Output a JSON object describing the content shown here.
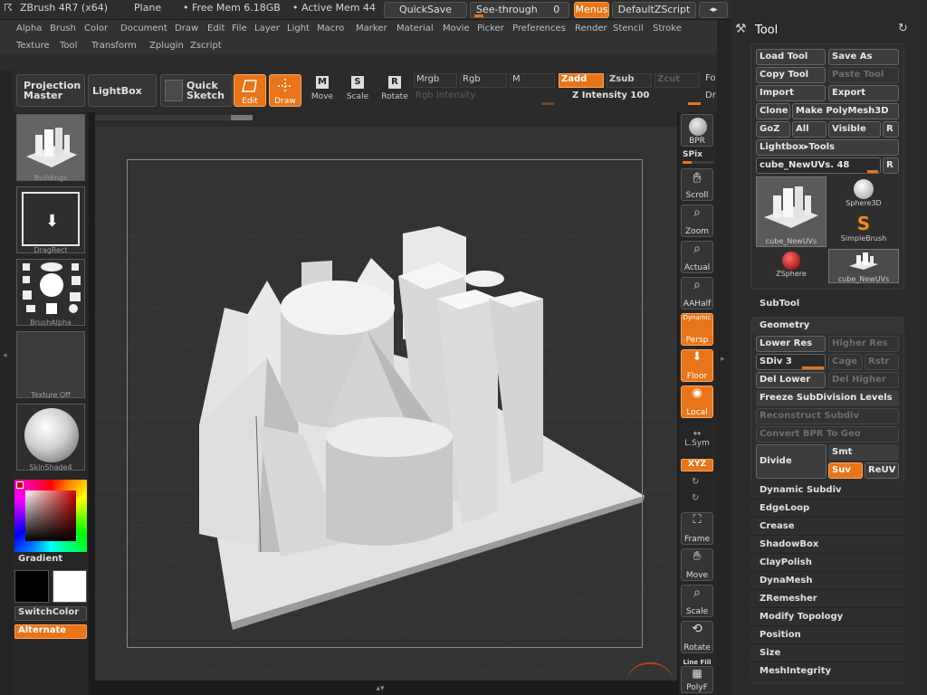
{
  "title": {
    "app": "ZBrush 4R7 (x64)",
    "doc": "Plane",
    "free_mem": "• Free Mem 6.18GB",
    "active_mem": "• Active Mem 44",
    "quicksave": "QuickSave",
    "see_through": "See-through",
    "see_through_value": "0",
    "menus": "Menus",
    "default_script": "DefaultZScript"
  },
  "menus": {
    "row1": [
      "Alpha",
      "Brush",
      "Color",
      "Document",
      "Draw",
      "Edit",
      "File",
      "Layer",
      "Light",
      "Macro",
      "Marker",
      "Material",
      "Movie",
      "Picker",
      "Preferences",
      "Render",
      "Stencil",
      "Stroke"
    ],
    "row2": [
      "Texture",
      "Tool",
      "Transform",
      "Zplugin",
      "Zscript"
    ]
  },
  "toolbar": {
    "projection": "Projection Master",
    "lightbox": "LightBox",
    "quick_sketch": "Quick Sketch",
    "edit": "Edit",
    "draw": "Draw",
    "move": "Move",
    "scale": "Scale",
    "rotate": "Rotate",
    "move_key": "M",
    "scale_key": "S",
    "rotate_key": "R",
    "mrgb": "Mrgb",
    "rgb": "Rgb",
    "m": "M",
    "zadd": "Zadd",
    "zsub": "Zsub",
    "zcut": "Zcut",
    "rgb_intensity": "Rgb Intensity",
    "z_intensity": "Z Intensity 100",
    "focal": "Fo",
    "draw_size": "Dr"
  },
  "left_shelf": {
    "buildings": "Buildings",
    "dragrect": "DragRect",
    "brushalpha": "BrushAlpha",
    "texture": "Texture Off",
    "skinshade": "SkinShade4",
    "gradient": "Gradient",
    "switchcolor": "SwitchColor",
    "alternate": "Alternate"
  },
  "right_shelf": {
    "bpr": "BPR",
    "spix": "SPix",
    "scroll": "Scroll",
    "zoom": "Zoom",
    "actual": "Actual",
    "aahalf": "AAHalf",
    "dynamic": "Dynamic",
    "persp": "Persp",
    "floor": "Floor",
    "local": "Local",
    "lsym": "L.Sym",
    "xyz": "XYZ",
    "frame": "Frame",
    "move": "Move",
    "scale": "Scale",
    "rotate": "Rotate",
    "line_fill": "Line Fill",
    "polyf": "PolyF"
  },
  "panel": {
    "title": "Tool",
    "load_tool": "Load Tool",
    "save_as": "Save As",
    "copy_tool": "Copy Tool",
    "paste_tool": "Paste Tool",
    "import": "Import",
    "export": "Export",
    "clone": "Clone",
    "make_polymesh": "Make PolyMesh3D",
    "goz": "GoZ",
    "all": "All",
    "visible": "Visible",
    "r": "R",
    "lightbox_tools": "Lightbox▸Tools",
    "current_tool": "cube_NewUVs. 48",
    "tools": [
      "cube_NewUVs",
      "Sphere3D",
      "SimpleBrush",
      "ZSphere",
      "cube_NewUVs"
    ],
    "subtool": "SubTool",
    "geometry": "Geometry",
    "lower_res": "Lower Res",
    "higher_res": "Higher Res",
    "sdiv": "SDiv 3",
    "cage": "Cage",
    "rstr": "Rstr",
    "del_lower": "Del Lower",
    "del_higher": "Del Higher",
    "freeze": "Freeze SubDivision Levels",
    "reconstruct": "Reconstruct Subdiv",
    "convert_bpr": "Convert BPR To Geo",
    "divide": "Divide",
    "smt": "Smt",
    "suv": "Suv",
    "reuv": "ReUV",
    "subsections": [
      "Dynamic Subdiv",
      "EdgeLoop",
      "Crease",
      "ShadowBox",
      "ClayPolish",
      "DynaMesh",
      "ZRemesher",
      "Modify Topology",
      "Position",
      "Size",
      "MeshIntegrity"
    ]
  }
}
